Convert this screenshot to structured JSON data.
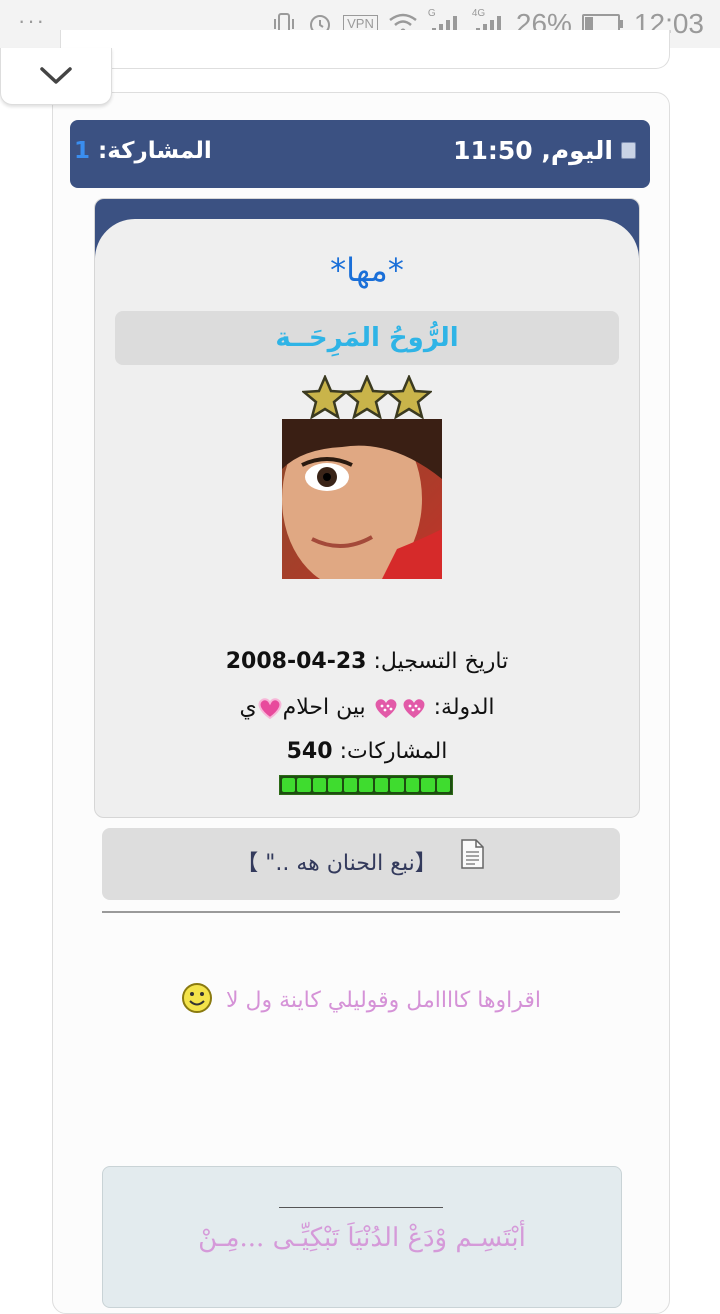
{
  "status_bar": {
    "menu_dots": "···",
    "vpn_label": "VPN",
    "network_g": "G",
    "network_4g": "4G",
    "battery_percent": "26%",
    "battery_level": 0.26,
    "time": "12:03"
  },
  "post": {
    "date_label": "اليوم, 11:50",
    "post_number_label": "المشاركة:",
    "post_number": "1",
    "user": {
      "name": "*مها*",
      "title": "الرُّوحُ المَرِحَــة",
      "star_count": 3,
      "registration_label": "تاريخ التسجيل:",
      "registration_date": "23-04-2008",
      "country_label": "الدولة:",
      "country_value": "بين احلام",
      "country_suffix": "ي",
      "posts_label": "المشاركات:",
      "posts_count": "540",
      "reputation_segments": 11
    },
    "thread_title": "【نبع الحنان هه ..\" 】",
    "body_text": "اقراوها كاااامل وقوليلي كاينة ول لا",
    "signature_text": "أبْتَسِـم وْدَعْ الدُنْيَاَ تَبْكِيِّـى ...مِـنْ"
  },
  "colors": {
    "header_bg": "#3b5182",
    "username": "#1a6fd8",
    "user_title": "#2fb4e6",
    "body_text": "#d592d7",
    "post_number": "#3a8ef0"
  },
  "icons": [
    "menu-dots-icon",
    "vibrate-icon",
    "alarm-icon",
    "wifi-icon",
    "signal-icon",
    "battery-icon",
    "chevron-down-icon",
    "star-icon",
    "heart-icon",
    "document-icon",
    "smiley-icon"
  ]
}
